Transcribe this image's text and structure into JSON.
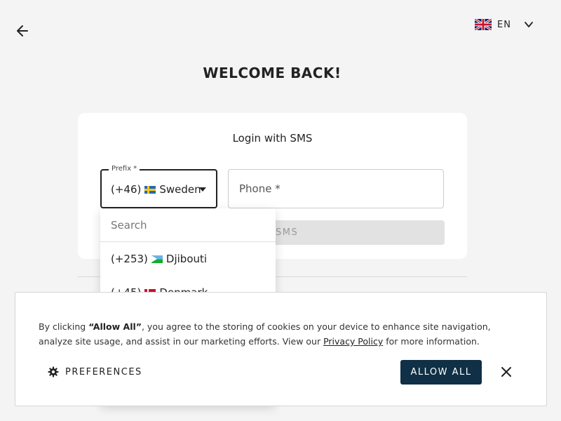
{
  "header": {
    "back_icon": "arrow-left-icon",
    "language": {
      "code": "EN",
      "flag_icon": "uk-flag-icon",
      "chevron_icon": "chevron-down-icon"
    }
  },
  "page_title": "WELCOME BACK!",
  "login_card": {
    "title": "Login with SMS",
    "prefix": {
      "label": "Prefix *",
      "value_code": "(+46)",
      "value_country": "Sweden",
      "flag_icon": "sweden-flag-icon"
    },
    "phone": {
      "placeholder": "Phone *"
    },
    "submit_label": "SMS"
  },
  "prefix_dropdown": {
    "search_placeholder": "Search",
    "items": [
      {
        "code": "(+253)",
        "country": "Djibouti",
        "flag_icon": "djibouti-flag-icon"
      },
      {
        "code": "(+45)",
        "country": "Denmark",
        "flag_icon": "denmark-flag-icon"
      }
    ]
  },
  "cookie_banner": {
    "text_prefix": "By clicking ",
    "text_bold": "“Allow All”",
    "text_middle": ", you agree to the storing of cookies on your device to enhance site navigation, analyze site usage, and assist in our marketing efforts. View our ",
    "link_label": "Privacy Policy",
    "text_suffix": " for more information.",
    "preferences_label": "PREFERENCES",
    "allow_all_label": "ALLOW ALL",
    "close_icon": "close-icon"
  },
  "colors": {
    "background": "#f4f4f4",
    "primary_button": "#0f3046",
    "disabled_button": "#e2e2e2"
  }
}
